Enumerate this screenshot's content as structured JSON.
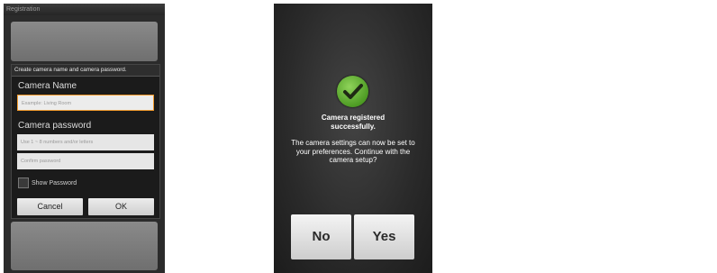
{
  "left_screen": {
    "title": "Registration",
    "dialog": {
      "header": "Create camera name and camera password.",
      "name_label": "Camera Name",
      "name_placeholder": "Example: Living Room",
      "password_label": "Camera password",
      "password_placeholder": "Use 1 ~ 8 numbers and/or letters",
      "confirm_placeholder": "Confirm password",
      "show_password_label": "Show Password",
      "show_password_checked": false,
      "cancel_label": "Cancel",
      "ok_label": "OK"
    }
  },
  "right_screen": {
    "status_icon": "checkmark-icon",
    "headline": "Camera registered successfully.",
    "message": "The camera settings can now be set to your preferences. Continue with the camera setup?",
    "no_label": "No",
    "yes_label": "Yes"
  }
}
